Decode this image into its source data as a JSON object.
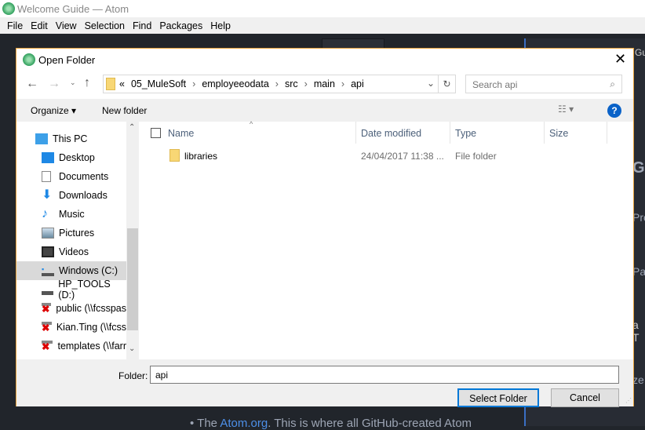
{
  "window": {
    "title": "Welcome Guide — Atom"
  },
  "menu": [
    "File",
    "Edit",
    "View",
    "Selection",
    "Find",
    "Packages",
    "Help"
  ],
  "background": {
    "side_texts": [
      "Gu",
      "G",
      "Pro",
      "Pac",
      "a T",
      "ze"
    ],
    "bottom_prefix": "The ",
    "bottom_link": "Atom.org",
    "bottom_suffix": ". This is where all GitHub-created Atom"
  },
  "dialog": {
    "title": "Open Folder",
    "breadcrumb": [
      "05_MuleSoft",
      "employeeodata",
      "src",
      "main",
      "api"
    ],
    "breadcrumb_overflow": "«",
    "search_placeholder": "Search api",
    "organize": "Organize ▾",
    "new_folder": "New folder",
    "nav": [
      "This PC",
      "Desktop",
      "Documents",
      "Downloads",
      "Music",
      "Pictures",
      "Videos",
      "Windows (C:)",
      "HP_TOOLS (D:)",
      "public (\\\\fcsspas",
      "Kian.Ting (\\\\fcss",
      "templates (\\\\farr"
    ],
    "columns": [
      "Name",
      "Date modified",
      "Type",
      "Size"
    ],
    "files": [
      {
        "name": "libraries",
        "date": "24/04/2017 11:38 ...",
        "type": "File folder",
        "size": ""
      }
    ],
    "folder_label": "Folder:",
    "folder_value": "api",
    "select_button": "Select Folder",
    "cancel_button": "Cancel"
  },
  "colors": {
    "accent": "#e8a33c",
    "primary_button_border": "#0078d7"
  }
}
